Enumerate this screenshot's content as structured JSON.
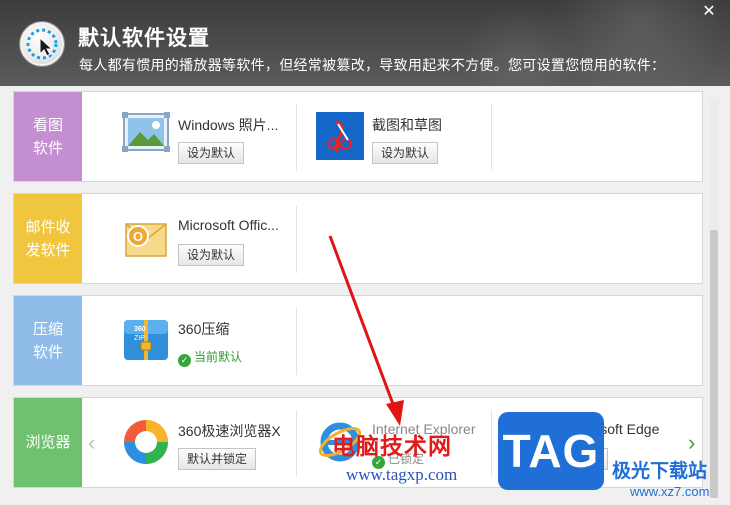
{
  "header": {
    "title": "默认软件设置",
    "subtitle": "每人都有惯用的播放器等软件，但经常被篡改，导致用起来不方便。您可设置您惯用的软件：",
    "close": "✕"
  },
  "categories": [
    {
      "label": "看图软件",
      "color": "#c38fd0",
      "apps": [
        {
          "name": "Windows 照片...",
          "button": "设为默认"
        },
        {
          "name": "截图和草图",
          "button": "设为默认"
        }
      ]
    },
    {
      "label": "邮件收发软件",
      "color": "#f0c63f",
      "apps": [
        {
          "name": "Microsoft Offic...",
          "button": "设为默认"
        }
      ]
    },
    {
      "label": "压缩软件",
      "color": "#8fbce8",
      "apps": [
        {
          "name": "360压缩",
          "status": "当前默认"
        }
      ]
    },
    {
      "label": "浏览器",
      "color": "#6fc16f",
      "apps": [
        {
          "name": "360极速浏览器X",
          "button": "默认并锁定"
        },
        {
          "name": "Internet Explorer",
          "status": "已锁定"
        },
        {
          "name": "Microsoft Edge",
          "button": "锁定"
        }
      ]
    }
  ],
  "nav": {
    "prev": "‹",
    "next": "›"
  },
  "watermark": {
    "text": "电脑技术网",
    "url": "www.tagxp.com",
    "tag": "TAG",
    "site_name": "极光下载站",
    "site_url": "www.xz7.com"
  }
}
